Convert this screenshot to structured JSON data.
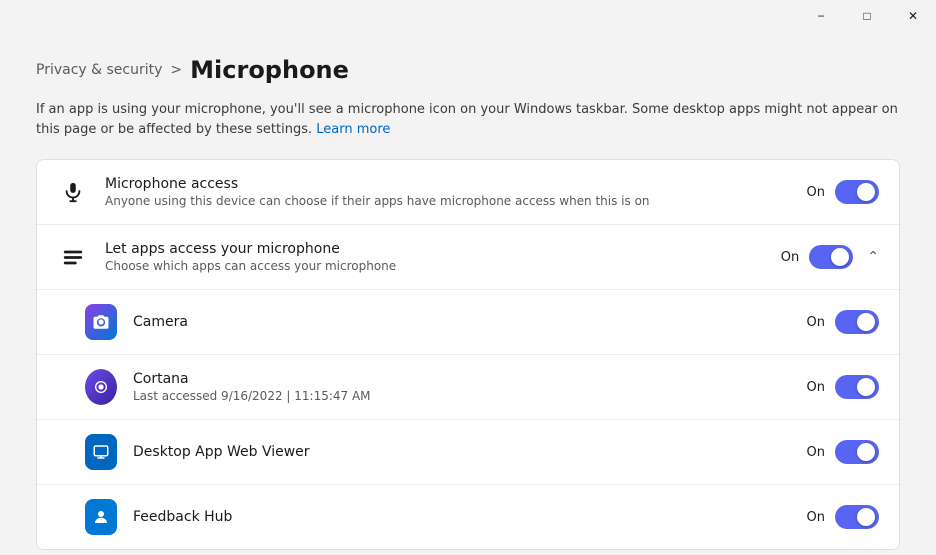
{
  "titlebar": {
    "minimize_label": "−",
    "maximize_label": "□",
    "close_label": "✕"
  },
  "breadcrumb": {
    "parent": "Privacy & security",
    "separator": ">",
    "current": "Microphone"
  },
  "description": {
    "text": "If an app is using your microphone, you'll see a microphone icon on your Windows taskbar. Some desktop apps might not appear on this page or be affected by these settings.",
    "link_text": "Learn more"
  },
  "settings": [
    {
      "id": "microphone-access",
      "icon_type": "mic",
      "title": "Microphone access",
      "subtitle": "Anyone using this device can choose if their apps have microphone access when this is on",
      "status": "On",
      "toggled": true,
      "expandable": false,
      "expanded": false,
      "is_sub": false
    },
    {
      "id": "let-apps-access",
      "icon_type": "apps",
      "title": "Let apps access your microphone",
      "subtitle": "Choose which apps can access your microphone",
      "status": "On",
      "toggled": true,
      "expandable": true,
      "expanded": true,
      "is_sub": false
    },
    {
      "id": "camera-app",
      "icon_type": "camera",
      "title": "Camera",
      "subtitle": "",
      "status": "On",
      "toggled": true,
      "expandable": false,
      "expanded": false,
      "is_sub": true
    },
    {
      "id": "cortana-app",
      "icon_type": "cortana",
      "title": "Cortana",
      "subtitle": "Last accessed 9/16/2022  |  11:15:47 AM",
      "status": "On",
      "toggled": true,
      "expandable": false,
      "expanded": false,
      "is_sub": true
    },
    {
      "id": "desktop-app-web-viewer",
      "icon_type": "desktop",
      "title": "Desktop App Web Viewer",
      "subtitle": "",
      "status": "On",
      "toggled": true,
      "expandable": false,
      "expanded": false,
      "is_sub": true
    },
    {
      "id": "feedback-hub",
      "icon_type": "feedback",
      "title": "Feedback Hub",
      "subtitle": "",
      "status": "On",
      "toggled": true,
      "expandable": false,
      "expanded": false,
      "is_sub": true
    }
  ]
}
